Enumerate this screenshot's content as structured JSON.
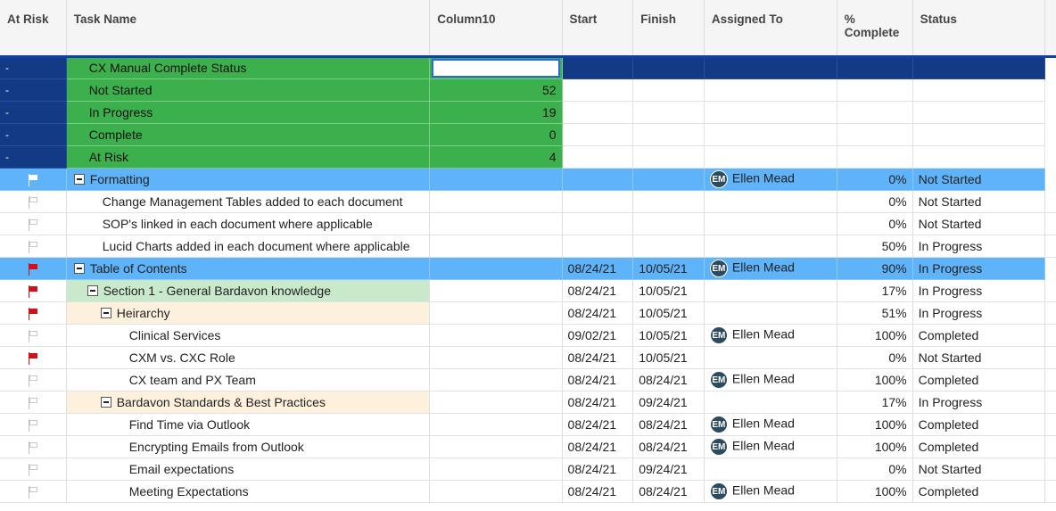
{
  "columns": {
    "at_risk": "At Risk",
    "task_name": "Task Name",
    "column10": "Column10",
    "start": "Start",
    "finish": "Finish",
    "assigned_to": "Assigned To",
    "pct_complete_line1": "%",
    "pct_complete_line2": "Complete",
    "status": "Status"
  },
  "summary_rows": [
    {
      "at_risk": "-",
      "task": "CX Manual Complete Status",
      "value": ""
    },
    {
      "at_risk": "-",
      "task": "Not Started",
      "value": "52"
    },
    {
      "at_risk": "-",
      "task": "In Progress",
      "value": "19"
    },
    {
      "at_risk": "-",
      "task": "Complete",
      "value": "0"
    },
    {
      "at_risk": "-",
      "task": "At Risk",
      "value": "4"
    }
  ],
  "task_rows": [
    {
      "flag": "white",
      "task": "Formatting",
      "start": "",
      "finish": "",
      "avatar": "EM",
      "assignee": "Ellen Mead",
      "pct": "0%",
      "status": "Not Started"
    },
    {
      "flag": "outline",
      "task": "Change Management Tables added to each document",
      "start": "",
      "finish": "",
      "avatar": "",
      "assignee": "",
      "pct": "0%",
      "status": "Not Started"
    },
    {
      "flag": "outline",
      "task": "SOP's linked in each document where applicable",
      "start": "",
      "finish": "",
      "avatar": "",
      "assignee": "",
      "pct": "0%",
      "status": "Not Started"
    },
    {
      "flag": "outline",
      "task": "Lucid Charts added in each document where applicable",
      "start": "",
      "finish": "",
      "avatar": "",
      "assignee": "",
      "pct": "50%",
      "status": "In Progress"
    },
    {
      "flag": "red",
      "task": "Table of Contents",
      "start": "08/24/21",
      "finish": "10/05/21",
      "avatar": "EM",
      "assignee": "Ellen Mead",
      "pct": "90%",
      "status": "In Progress"
    },
    {
      "flag": "red",
      "task": "Section 1 - General Bardavon knowledge",
      "start": "08/24/21",
      "finish": "10/05/21",
      "avatar": "",
      "assignee": "",
      "pct": "17%",
      "status": "In Progress"
    },
    {
      "flag": "red",
      "task": "Heirarchy",
      "start": "08/24/21",
      "finish": "10/05/21",
      "avatar": "",
      "assignee": "",
      "pct": "51%",
      "status": "In Progress"
    },
    {
      "flag": "outline",
      "task": "Clinical Services",
      "start": "09/02/21",
      "finish": "10/05/21",
      "avatar": "EM",
      "assignee": "Ellen Mead",
      "pct": "100%",
      "status": "Completed"
    },
    {
      "flag": "red",
      "task": "CXM vs. CXC Role",
      "start": "08/24/21",
      "finish": "10/05/21",
      "avatar": "",
      "assignee": "",
      "pct": "0%",
      "status": "Not Started"
    },
    {
      "flag": "outline",
      "task": "CX team and PX Team",
      "start": "08/24/21",
      "finish": "08/24/21",
      "avatar": "EM",
      "assignee": "Ellen Mead",
      "pct": "100%",
      "status": "Completed"
    },
    {
      "flag": "outline",
      "task": "Bardavon Standards & Best Practices",
      "start": "08/24/21",
      "finish": "09/24/21",
      "avatar": "",
      "assignee": "",
      "pct": "17%",
      "status": "In Progress"
    },
    {
      "flag": "outline",
      "task": "Find Time via Outlook",
      "start": "08/24/21",
      "finish": "08/24/21",
      "avatar": "EM",
      "assignee": "Ellen Mead",
      "pct": "100%",
      "status": "Completed"
    },
    {
      "flag": "outline",
      "task": "Encrypting Emails from Outlook",
      "start": "08/24/21",
      "finish": "08/24/21",
      "avatar": "EM",
      "assignee": "Ellen Mead",
      "pct": "100%",
      "status": "Completed"
    },
    {
      "flag": "outline",
      "task": "Email expectations",
      "start": "08/24/21",
      "finish": "09/24/21",
      "avatar": "",
      "assignee": "",
      "pct": "0%",
      "status": "Not Started"
    },
    {
      "flag": "outline",
      "task": "Meeting Expectations",
      "start": "08/24/21",
      "finish": "08/24/21",
      "avatar": "EM",
      "assignee": "Ellen Mead",
      "pct": "100%",
      "status": "Completed"
    }
  ]
}
